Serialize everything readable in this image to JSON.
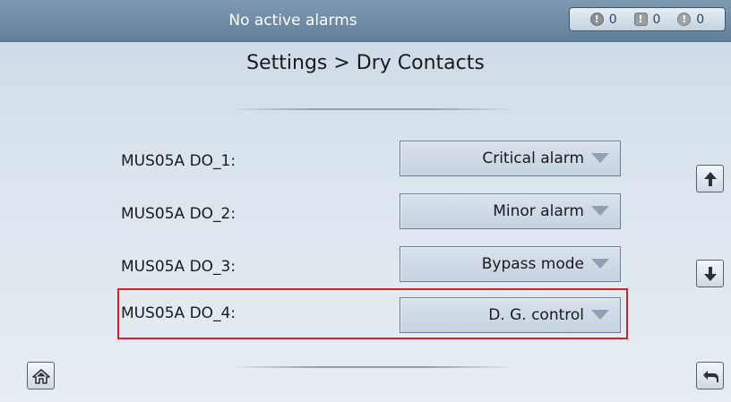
{
  "header": {
    "alarm_status": "No active alarms",
    "counters": [
      {
        "severity": "critical",
        "icon": "critical-alarm-icon",
        "count": "0"
      },
      {
        "severity": "major",
        "icon": "major-alarm-icon",
        "count": "0"
      },
      {
        "severity": "minor",
        "icon": "minor-alarm-icon",
        "count": "0"
      }
    ]
  },
  "page": {
    "title": "Settings > Dry Contacts"
  },
  "rows": [
    {
      "label": "MUS05A DO_1:",
      "value": "Critical alarm"
    },
    {
      "label": "MUS05A DO_2:",
      "value": "Minor alarm"
    },
    {
      "label": "MUS05A DO_3:",
      "value": "Bypass mode"
    },
    {
      "label": "MUS05A DO_4:",
      "value": "D. G. control"
    }
  ],
  "colors": {
    "header_bg": "#6f8ba4",
    "highlight": "#d2232a",
    "page_bg": "#dae4ed"
  },
  "icons": {
    "scroll_up": "arrow-up-icon",
    "scroll_down": "arrow-down-icon",
    "home": "home-icon",
    "back": "back-icon"
  }
}
